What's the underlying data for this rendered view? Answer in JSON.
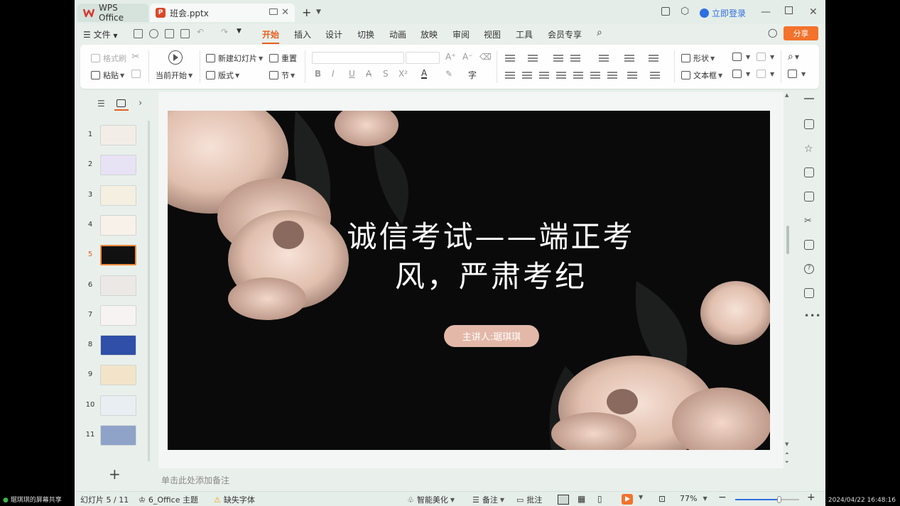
{
  "colors": {
    "accent": "#e8601c",
    "share": "#f3722c",
    "link": "#2f6ee0",
    "slide_bg": "#0a0a0a",
    "pill": "#e3b8a8"
  },
  "tabs": [
    {
      "label": "WPS Office",
      "icon": "wps-logo-icon"
    },
    {
      "label": "班会.pptx",
      "icon": "ppt-file-icon"
    }
  ],
  "titlebar": {
    "login": "立即登录"
  },
  "menu": {
    "file": "文件",
    "items": [
      "开始",
      "插入",
      "设计",
      "切换",
      "动画",
      "放映",
      "审阅",
      "视图",
      "工具",
      "会员专享"
    ],
    "active": "开始",
    "share": "分享"
  },
  "ribbon": {
    "format_painter": "格式刷",
    "paste": "粘贴",
    "start_from_current": "当前开始",
    "new_slide": "新建幻灯片",
    "layout": "版式",
    "reset": "重置",
    "section": "节",
    "shape": "形状",
    "textbox": "文本框"
  },
  "slides": {
    "numbers": [
      "1",
      "2",
      "3",
      "4",
      "5",
      "6",
      "7",
      "8",
      "9",
      "10",
      "11"
    ],
    "active_index": 5
  },
  "slide": {
    "title_line1": "诚信考试——端正考",
    "title_line2": "风，严肃考纪",
    "host": "主讲人:琚琪琪"
  },
  "notes_placeholder": "单击此处添加备注",
  "status": {
    "slide_count": "幻灯片 5 / 11",
    "theme": "6_Office 主题",
    "missing_font": "缺失字体",
    "beautify": "智能美化",
    "notes": "备注",
    "comments": "批注",
    "zoom": "77%",
    "zoom_fraction": 0.77
  },
  "taskbar": {
    "left": "琚琪琪的屏幕共享",
    "right": "2024/04/22 16:48:16"
  }
}
